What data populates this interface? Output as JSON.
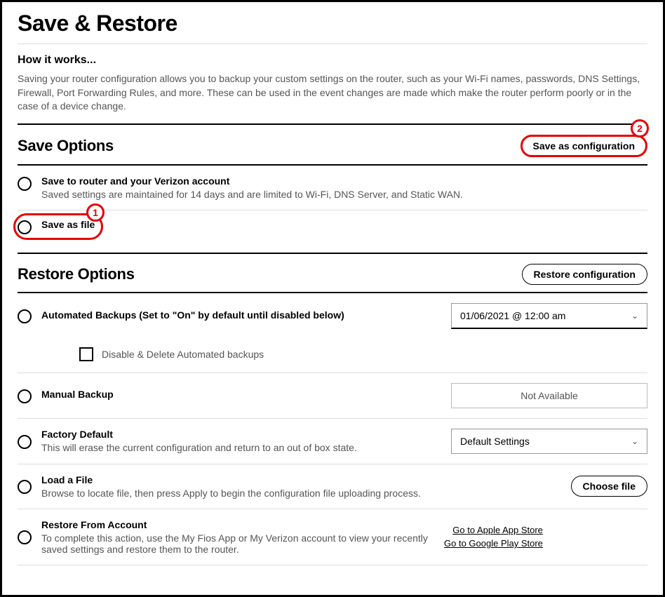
{
  "page": {
    "title": "Save & Restore"
  },
  "how": {
    "heading": "How it works...",
    "body": "Saving your router configuration allows you to backup your custom settings on the router, such as your Wi-Fi names, passwords, DNS Settings, Firewall, Port Forwarding Rules, and more. These can be used in the event changes are made which make the router perform poorly or in the case of a device change."
  },
  "save": {
    "heading": "Save Options",
    "button": "Save as configuration",
    "opt1_title": "Save to router and your Verizon account",
    "opt1_desc": "Saved settings are maintained for 14 days and are limited to Wi-Fi, DNS Server, and Static WAN.",
    "opt2_title": "Save as file"
  },
  "restore": {
    "heading": "Restore Options",
    "button": "Restore configuration",
    "auto_title": "Automated Backups (Set to \"On\" by default until disabled below)",
    "auto_value": "01/06/2021 @ 12:00 am",
    "disable_label": "Disable & Delete Automated backups",
    "manual_title": "Manual Backup",
    "manual_value": "Not Available",
    "factory_title": "Factory Default",
    "factory_desc": "This will erase the current configuration and return to an out of box state.",
    "factory_value": "Default Settings",
    "load_title": "Load a File",
    "load_desc": "Browse to locate file, then press Apply to begin the configuration file uploading process.",
    "choose_file": "Choose file",
    "account_title": "Restore From Account",
    "account_desc": "To complete this action, use the My Fios App or My Verizon account to view your recently saved settings and restore them to the router.",
    "apple_link": "Go to Apple App Store",
    "google_link": "Go to Google Play Store"
  },
  "annotations": {
    "one": "1",
    "two": "2"
  }
}
